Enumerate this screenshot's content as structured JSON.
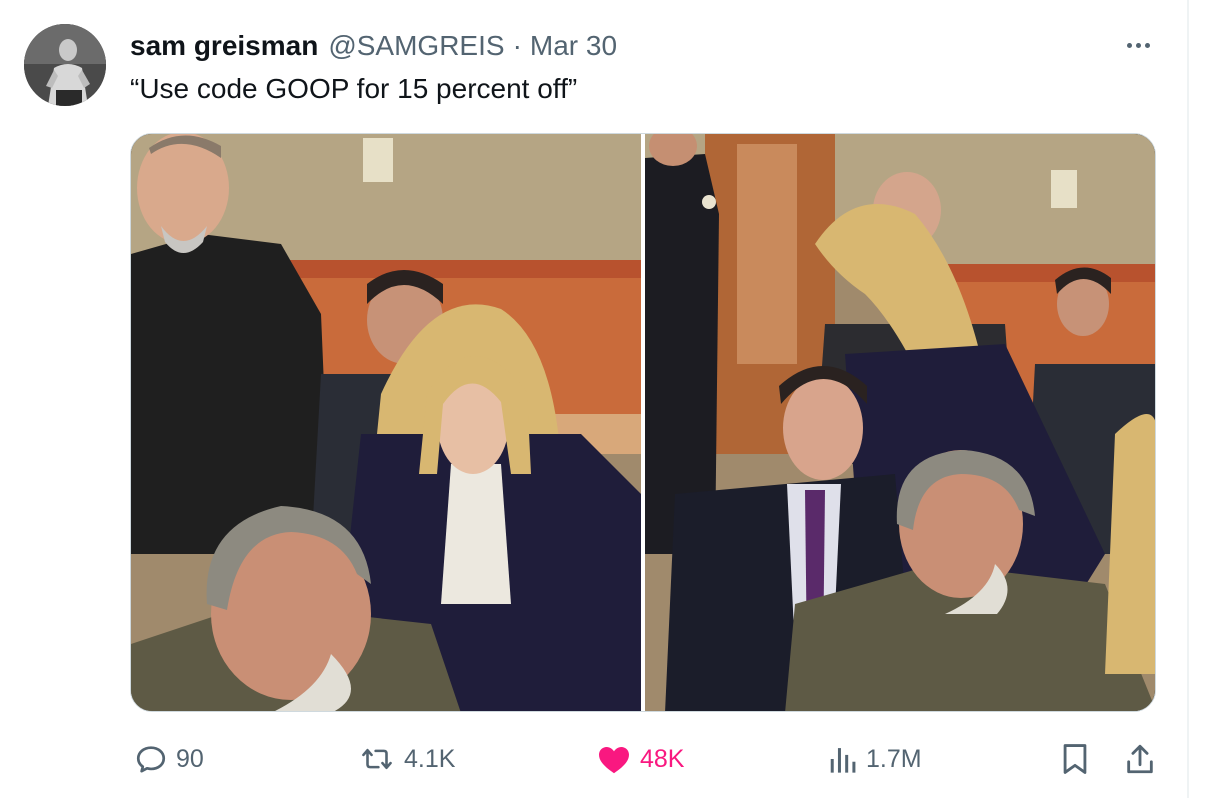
{
  "tweet": {
    "author_name": "sam greisman",
    "author_handle": "@SAMGREIS",
    "separator": "·",
    "date": "Mar 30",
    "text": "“Use code GOOP for 15 percent off”",
    "media_description": "Two courtroom stills side by side"
  },
  "actions": {
    "replies": "90",
    "retweets": "4.1K",
    "likes": "48K",
    "views": "1.7M"
  },
  "colors": {
    "like_pink": "#f91880",
    "muted_gray": "#536471",
    "text": "#0f1419",
    "border": "#cfd9de"
  },
  "icons": [
    "avatar",
    "more-options-icon",
    "reply-icon",
    "retweet-icon",
    "like-heart-icon",
    "views-chart-icon",
    "bookmark-icon",
    "share-icon"
  ]
}
